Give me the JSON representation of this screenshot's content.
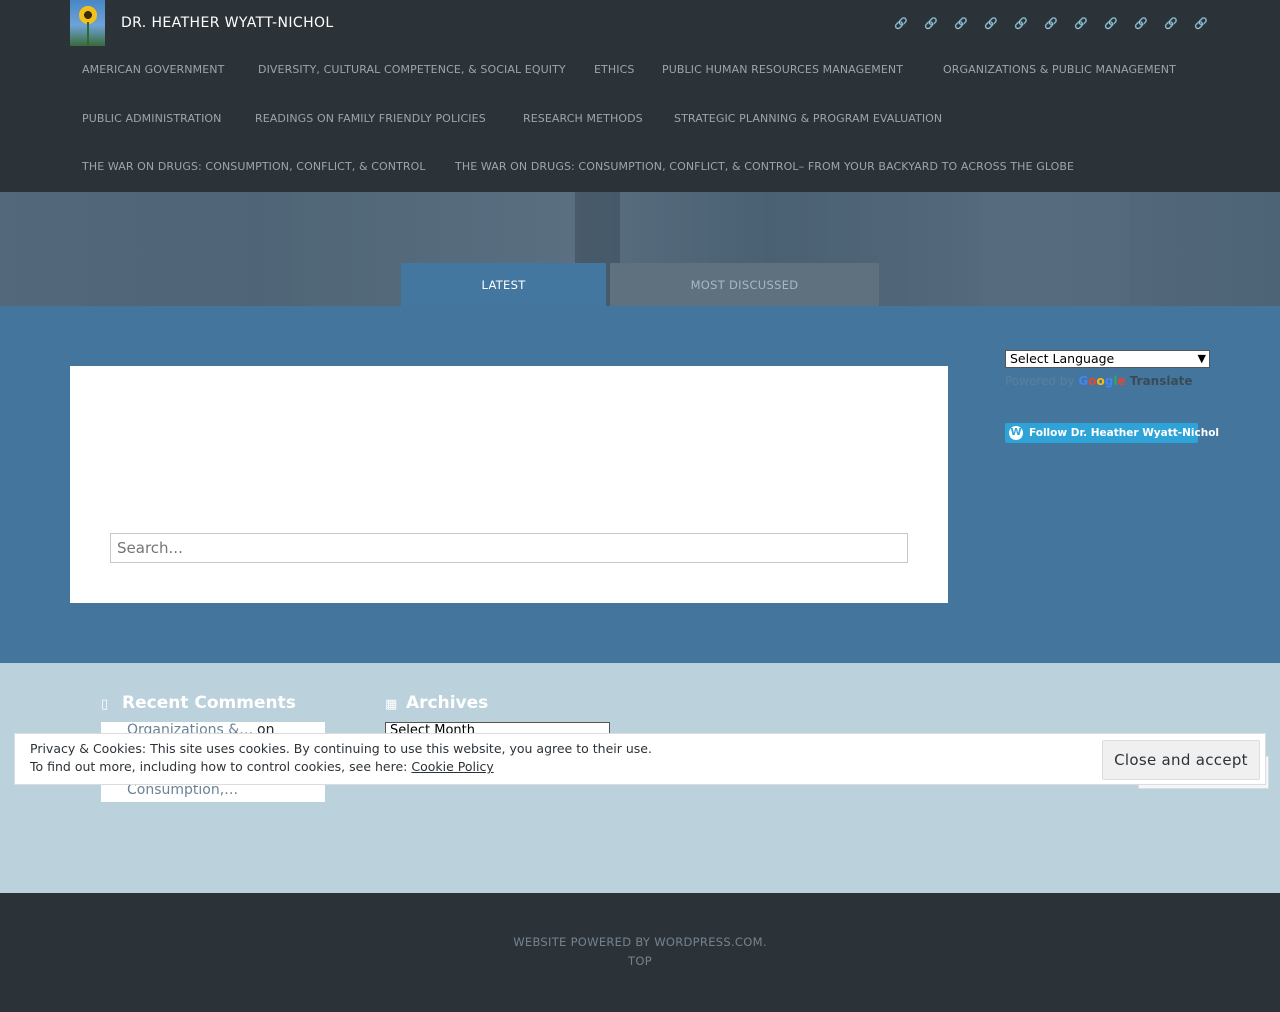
{
  "header": {
    "site_title": "DR. HEATHER WYATT-NICHOL",
    "social_icon": "link-icon",
    "social_glyph": "🔗"
  },
  "nav": [
    "AMERICAN GOVERNMENT",
    "DIVERSITY, CULTURAL COMPETENCE, & SOCIAL EQUITY",
    "ETHICS",
    "PUBLIC HUMAN RESOURCES MANAGEMENT",
    "ORGANIZATIONS & PUBLIC MANAGEMENT",
    "PUBLIC ADMINISTRATION",
    "READINGS ON FAMILY FRIENDLY POLICIES",
    "RESEARCH METHODS",
    "STRATEGIC PLANNING & PROGRAM EVALUATION",
    "THE WAR ON DRUGS: CONSUMPTION, CONFLICT, & CONTROL",
    "THE WAR ON DRUGS: CONSUMPTION, CONFLICT, & CONTROL– FROM YOUR BACKYARD TO ACROSS THE GLOBE"
  ],
  "tabs": {
    "latest": "LATEST",
    "most_discussed": "MOST DISCUSSED"
  },
  "search": {
    "placeholder": "Search..."
  },
  "sidebar": {
    "language_select": "Select Language",
    "powered_by": "Powered by",
    "google_letters": [
      "G",
      "o",
      "o",
      "g",
      "l",
      "e"
    ],
    "google_colors": [
      "#4285f4",
      "#ea4335",
      "#fbbc05",
      "#4285f4",
      "#34a853",
      "#ea4335"
    ],
    "translate": "Translate",
    "follow_button": "Follow Dr. Heather Wyatt-Nichol"
  },
  "widgets": {
    "recent_comments_title": "Recent Comments",
    "recent_comment_link": "Organizations &…",
    "recent_comment_on": "on",
    "recent_comment_post": "Consumption,…",
    "archives_title": "Archives",
    "archives_select": "Select Month"
  },
  "cookie": {
    "line1": "Privacy & Cookies: This site uses cookies. By continuing to use this website, you agree to their use.",
    "line2_prefix": "To find out more, including how to control cookies, see here: ",
    "link": "Cookie Policy",
    "accept": "Close and accept"
  },
  "footer": {
    "powered": "WEBSITE POWERED BY WORDPRESS.COM.",
    "top": "TOP"
  }
}
